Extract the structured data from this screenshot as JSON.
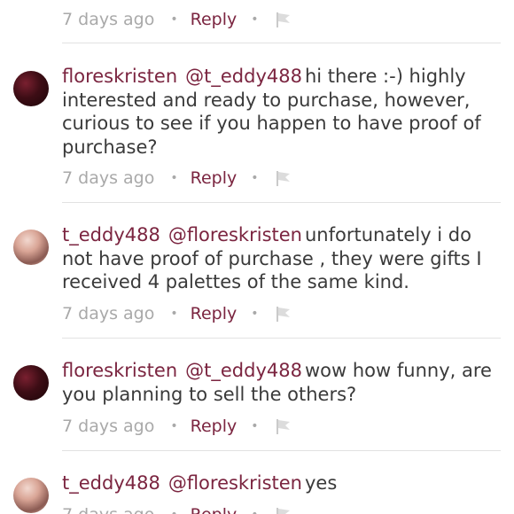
{
  "meta": {
    "time": "7 days ago",
    "dot": "•",
    "reply": "Reply"
  },
  "comments": [
    {
      "user": "floreskristen",
      "mention": "@t_eddy488",
      "text": "hi there :-) highly interested and ready to purchase, however, curious to see if you happen to have proof of purchase?"
    },
    {
      "user": "t_eddy488",
      "mention": "@floreskristen",
      "text": "unfortunately i do not have proof of purchase , they were gifts I received 4 palettes of the same kind."
    },
    {
      "user": "floreskristen",
      "mention": "@t_eddy488",
      "text": "wow how funny, are you planning to sell the others?"
    },
    {
      "user": "t_eddy488",
      "mention": "@floreskristen",
      "text": "yes"
    }
  ]
}
